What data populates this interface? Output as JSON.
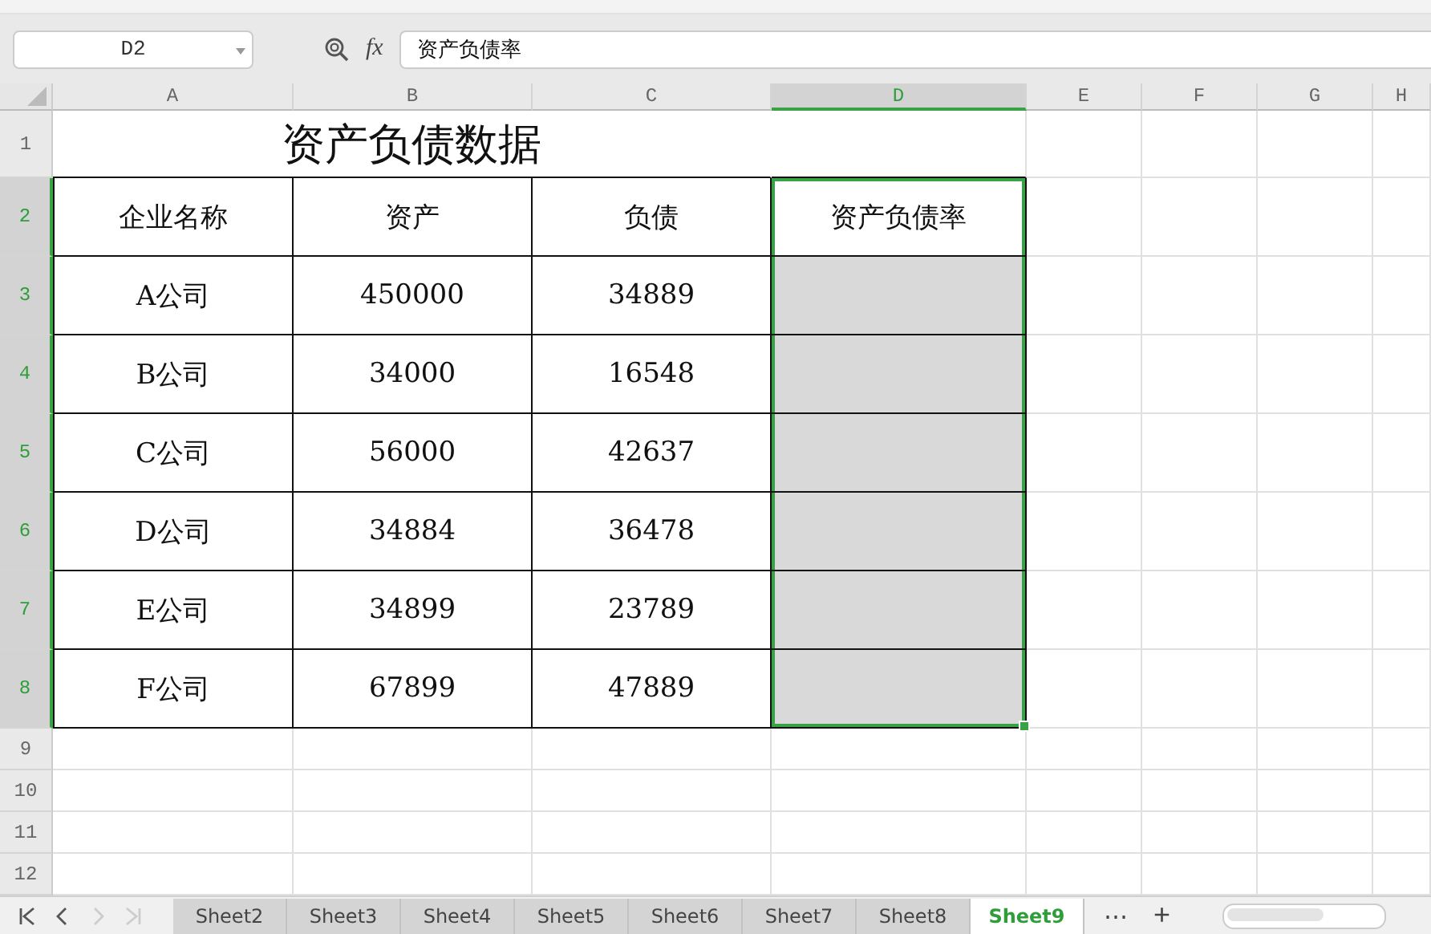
{
  "formula_bar": {
    "name_box": "D2",
    "function_label": "fx",
    "formula": "资产负债率"
  },
  "columns": [
    {
      "label": "A",
      "selected": false
    },
    {
      "label": "B",
      "selected": false
    },
    {
      "label": "C",
      "selected": false
    },
    {
      "label": "D",
      "selected": true
    },
    {
      "label": "E",
      "selected": false
    },
    {
      "label": "F",
      "selected": false
    },
    {
      "label": "G",
      "selected": false
    },
    {
      "label": "H",
      "selected": false
    }
  ],
  "rows": [
    {
      "number": "1",
      "selected": false,
      "kind": "title",
      "title": "资产负债数据"
    },
    {
      "number": "2",
      "selected": true,
      "kind": "data",
      "cells": [
        {
          "text": "企业名称"
        },
        {
          "text": "资产"
        },
        {
          "text": "负债"
        },
        {
          "text": "资产负债率",
          "selected": true,
          "active": true
        }
      ]
    },
    {
      "number": "3",
      "selected": true,
      "kind": "data",
      "cells": [
        {
          "text": "A公司"
        },
        {
          "text": "450000"
        },
        {
          "text": "34889"
        },
        {
          "selected": true,
          "active": false
        }
      ]
    },
    {
      "number": "4",
      "selected": true,
      "kind": "data",
      "cells": [
        {
          "text": "B公司"
        },
        {
          "text": "34000"
        },
        {
          "text": "16548"
        },
        {
          "selected": true,
          "active": false
        }
      ]
    },
    {
      "number": "5",
      "selected": true,
      "kind": "data",
      "cells": [
        {
          "text": "C公司"
        },
        {
          "text": "56000"
        },
        {
          "text": "42637"
        },
        {
          "selected": true,
          "active": false
        }
      ]
    },
    {
      "number": "6",
      "selected": true,
      "kind": "data",
      "cells": [
        {
          "text": "D公司"
        },
        {
          "text": "34884"
        },
        {
          "text": "36478"
        },
        {
          "selected": true,
          "active": false
        }
      ]
    },
    {
      "number": "7",
      "selected": true,
      "kind": "data",
      "cells": [
        {
          "text": "E公司"
        },
        {
          "text": "34899"
        },
        {
          "text": "23789"
        },
        {
          "selected": true,
          "active": false
        }
      ]
    },
    {
      "number": "8",
      "selected": true,
      "kind": "data",
      "cells": [
        {
          "text": "F公司"
        },
        {
          "text": "67899"
        },
        {
          "text": "47889"
        },
        {
          "selected": true,
          "active": false
        }
      ]
    },
    {
      "number": "9",
      "selected": false,
      "kind": "empty"
    },
    {
      "number": "10",
      "selected": false,
      "kind": "empty"
    },
    {
      "number": "11",
      "selected": false,
      "kind": "empty"
    },
    {
      "number": "12",
      "selected": false,
      "kind": "empty"
    }
  ],
  "sheet_tabs": [
    {
      "label": "Sheet2",
      "selected": false
    },
    {
      "label": "Sheet3",
      "selected": false
    },
    {
      "label": "Sheet4",
      "selected": false
    },
    {
      "label": "Sheet5",
      "selected": false
    },
    {
      "label": "Sheet6",
      "selected": false
    },
    {
      "label": "Sheet7",
      "selected": false
    },
    {
      "label": "Sheet8",
      "selected": false
    },
    {
      "label": "Sheet9",
      "selected": true
    }
  ],
  "tab_actions": {
    "more": "⋯",
    "add": "+"
  }
}
